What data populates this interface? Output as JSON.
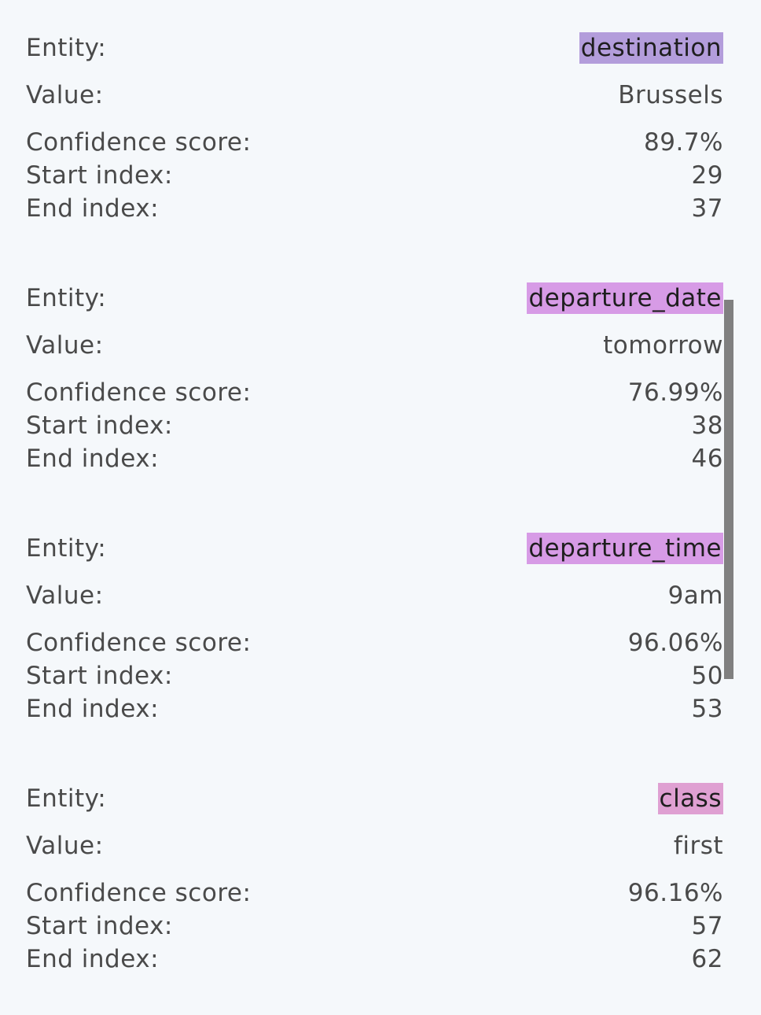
{
  "labels": {
    "entity": "Entity:",
    "value": "Value:",
    "confidence": "Confidence score:",
    "start": "Start index:",
    "end": "End index:"
  },
  "entities": [
    {
      "entity": "destination",
      "value": "Brussels",
      "confidence": "89.7%",
      "start_index": "29",
      "end_index": "37",
      "tag_color": "#b39ddb"
    },
    {
      "entity": "departure_date",
      "value": "tomorrow",
      "confidence": "76.99%",
      "start_index": "38",
      "end_index": "46",
      "tag_color": "#d79be6"
    },
    {
      "entity": "departure_time",
      "value": "9am",
      "confidence": "96.06%",
      "start_index": "50",
      "end_index": "53",
      "tag_color": "#d79be6"
    },
    {
      "entity": "class",
      "value": "first",
      "confidence": "96.16%",
      "start_index": "57",
      "end_index": "62",
      "tag_color": "#dfa0d2"
    }
  ]
}
